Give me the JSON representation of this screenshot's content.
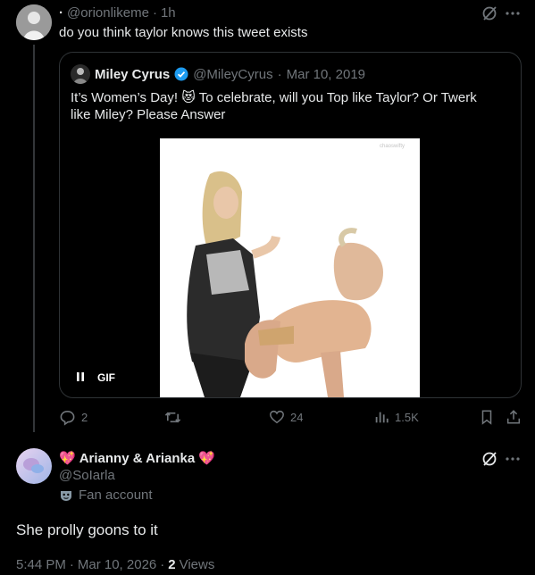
{
  "tweet1": {
    "handle": "@orionlikeme",
    "dot": "·",
    "time": "1h",
    "text": "do you think taylor knows this tweet exists"
  },
  "quote": {
    "name": "Miley Cyrus",
    "handle": "@MileyCyrus",
    "dot": "·",
    "date": "Mar 10, 2019",
    "text_line1": "It’s Women’s Day! 😻 To celebrate, will  you Top like Taylor? Or Twerk",
    "text_line2": "like Miley? Please Answer",
    "watermark": "chaoswifty",
    "gif_label": "GIF"
  },
  "actions": {
    "replies": "2",
    "likes": "24",
    "views": "1.5K"
  },
  "reply": {
    "name": "Arianny & Arianka",
    "emoji_left": "💖",
    "emoji_right": "💖",
    "handle": "@SoIarla",
    "label": "Fan account",
    "text": "She prolly goons to it",
    "time": "5:44 PM",
    "date": "Mar 10, 2026",
    "views_count": "2",
    "views_label": "Views",
    "dot": "·"
  },
  "colors": {
    "background": "#000000",
    "text": "#e7e9ea",
    "muted": "#71767b",
    "border": "#2f3336",
    "verified": "#1d9bf0",
    "heart": "#e0245e"
  }
}
